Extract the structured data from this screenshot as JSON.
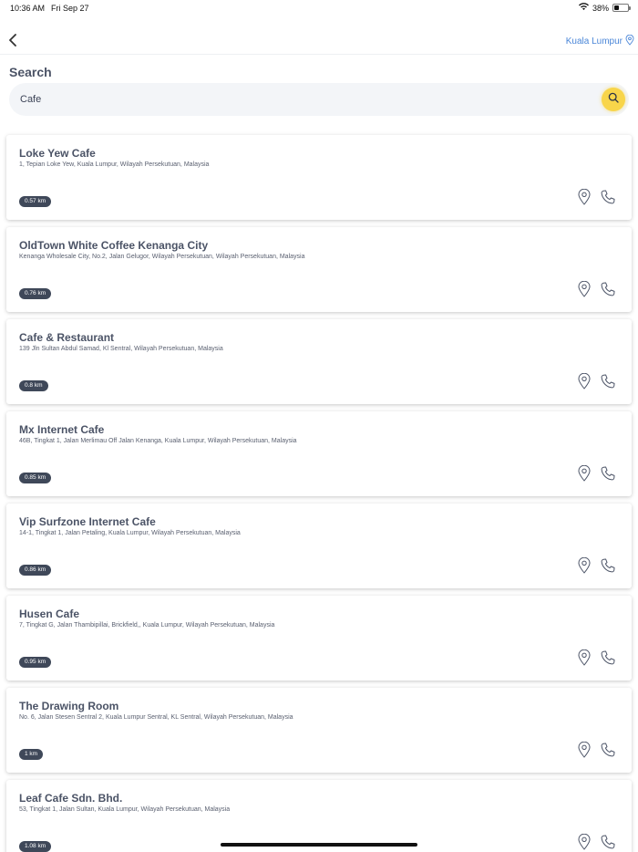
{
  "status_bar": {
    "time": "10:36 AM",
    "date": "Fri Sep 27",
    "battery": "38%",
    "battery_level": 0.38
  },
  "nav": {
    "location": "Kuala Lumpur"
  },
  "search": {
    "title": "Search",
    "query": "Cafe"
  },
  "results": [
    {
      "name": "Loke Yew Cafe",
      "address": "1, Tepian Loke Yew, Kuala Lumpur, Wilayah Persekutuan, Malaysia",
      "distance": "0.57 km"
    },
    {
      "name": "OldTown White Coffee Kenanga City",
      "address": "Kenanga Wholesale City, No.2, Jalan Gelugor, Wilayah Persekutuan, Wilayah Persekutuan, Malaysia",
      "distance": "0.76 km"
    },
    {
      "name": "Cafe & Restaurant",
      "address": "139 Jln Sultan Abdul Samad, Kl Sentral, Wilayah Persekutuan, Malaysia",
      "distance": "0.8 km"
    },
    {
      "name": "Mx Internet Cafe",
      "address": "46B, Tingkat 1, Jalan Merlimau Off Jalan Kenanga, Kuala Lumpur, Wilayah Persekutuan, Malaysia",
      "distance": "0.85 km"
    },
    {
      "name": "Vip Surfzone Internet Cafe",
      "address": "14-1, Tingkat 1, Jalan Petaling, Kuala Lumpur, Wilayah Persekutuan, Malaysia",
      "distance": "0.86 km"
    },
    {
      "name": "Husen Cafe",
      "address": "7, Tingkat G, Jalan Thambipillai, Brickfield,, Kuala Lumpur, Wilayah Persekutuan, Malaysia",
      "distance": "0.95 km"
    },
    {
      "name": "The Drawing Room",
      "address": "No. 6, Jalan Stesen Sentral 2, Kuala Lumpur Sentral, KL Sentral, Wilayah Persekutuan, Malaysia",
      "distance": "1 km"
    },
    {
      "name": "Leaf Cafe Sdn. Bhd.",
      "address": "53, Tingkat 1, Jalan Sultan, Kuala Lumpur, Wilayah Persekutuan, Malaysia",
      "distance": "1.08 km"
    }
  ],
  "icons": {
    "back": "chevron-left-icon",
    "location": "map-pin-icon",
    "search": "search-icon",
    "directions": "map-pin-icon",
    "call": "phone-icon"
  },
  "colors": {
    "accent_blue": "#4a86d8",
    "search_yellow": "#f8d54a",
    "badge_dark": "#3f4859",
    "text_dark": "#4b5366"
  }
}
